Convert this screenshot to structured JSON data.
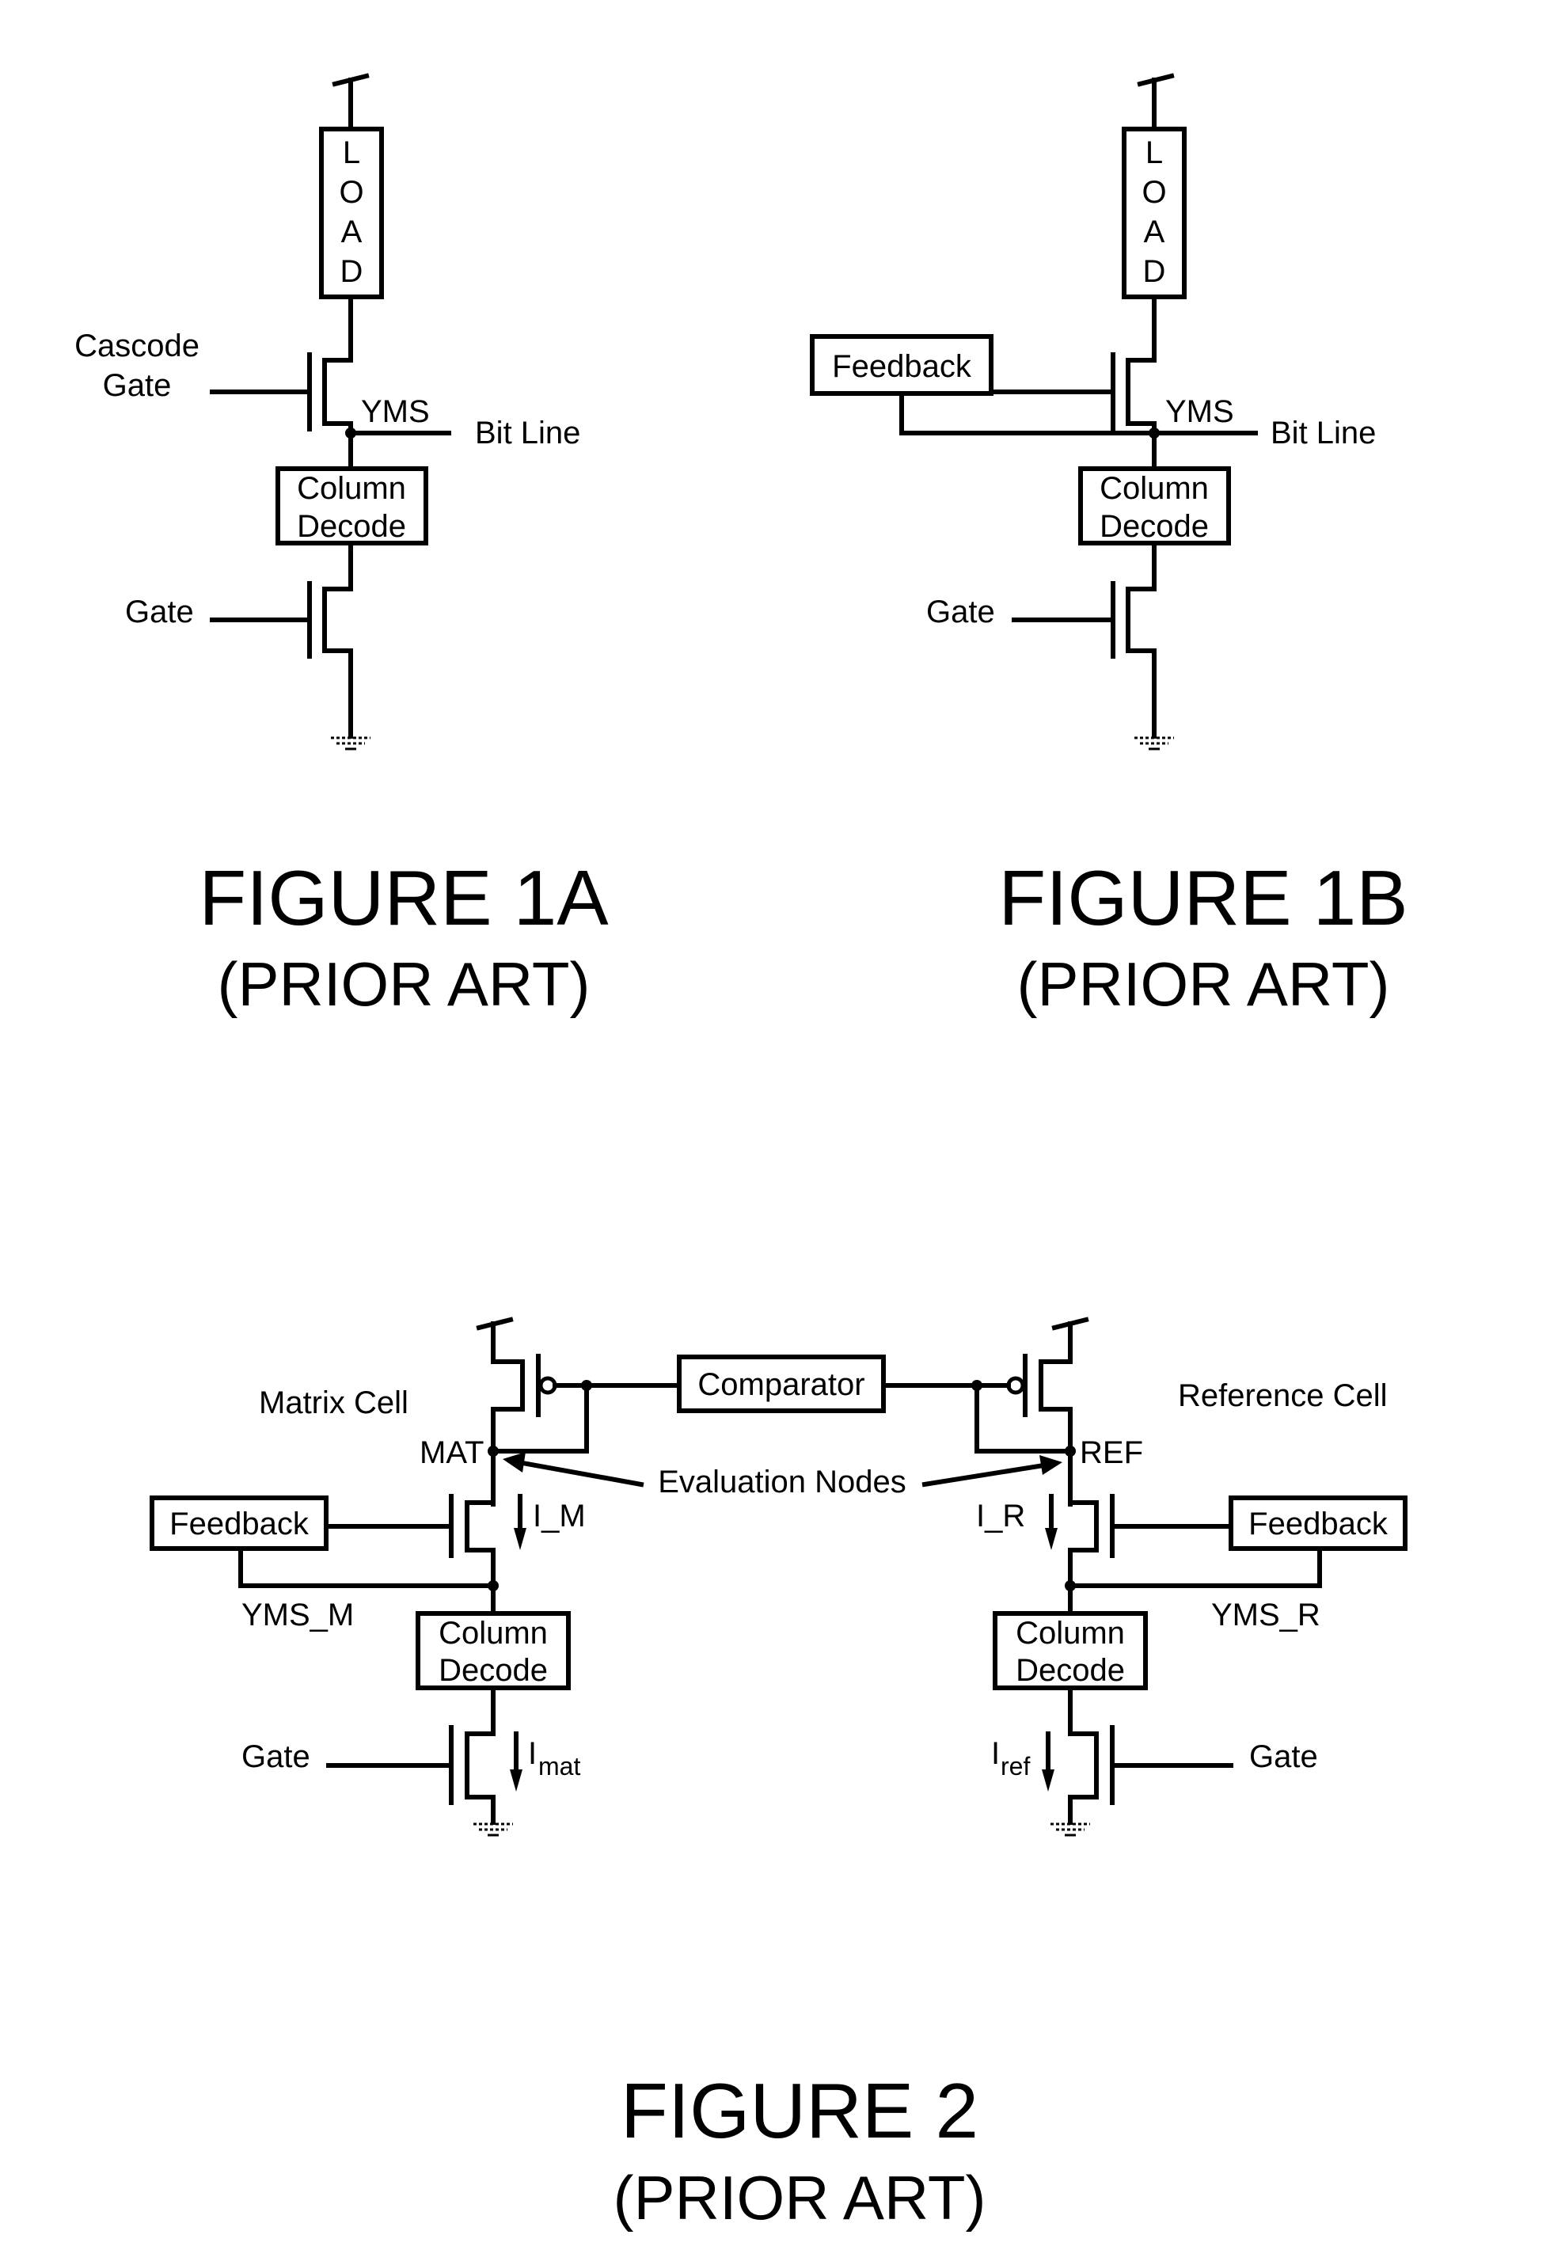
{
  "figures": [
    {
      "id": "1A",
      "caption": "FIGURE 1A",
      "subcaption": "(PRIOR ART)",
      "labels": {
        "load": [
          "L",
          "O",
          "A",
          "D"
        ],
        "cascode_gate_line1": "Cascode",
        "cascode_gate_line2": "Gate",
        "node": "YMS",
        "bit_line": "Bit Line",
        "column_decode_line1": "Column",
        "column_decode_line2": "Decode",
        "gate": "Gate"
      }
    },
    {
      "id": "1B",
      "caption": "FIGURE 1B",
      "subcaption": "(PRIOR ART)",
      "labels": {
        "load": [
          "L",
          "O",
          "A",
          "D"
        ],
        "feedback": "Feedback",
        "node": "YMS",
        "bit_line": "Bit Line",
        "column_decode_line1": "Column",
        "column_decode_line2": "Decode",
        "gate": "Gate"
      }
    },
    {
      "id": "2",
      "caption": "FIGURE 2",
      "subcaption": "(PRIOR ART)",
      "labels": {
        "comparator": "Comparator",
        "matrix_cell": "Matrix Cell",
        "reference_cell": "Reference Cell",
        "mat_node": "MAT",
        "ref_node": "REF",
        "evaluation_nodes": "Evaluation Nodes",
        "feedback_left": "Feedback",
        "feedback_right": "Feedback",
        "i_m": "I_M",
        "i_r": "I_R",
        "yms_m": "YMS_M",
        "yms_r": "YMS_R",
        "column_decode_line1": "Column",
        "column_decode_line2": "Decode",
        "gate_left": "Gate",
        "gate_right": "Gate",
        "i_mat_main": "I",
        "i_mat_sub": "mat",
        "i_ref_main": "I",
        "i_ref_sub": "ref"
      }
    }
  ]
}
